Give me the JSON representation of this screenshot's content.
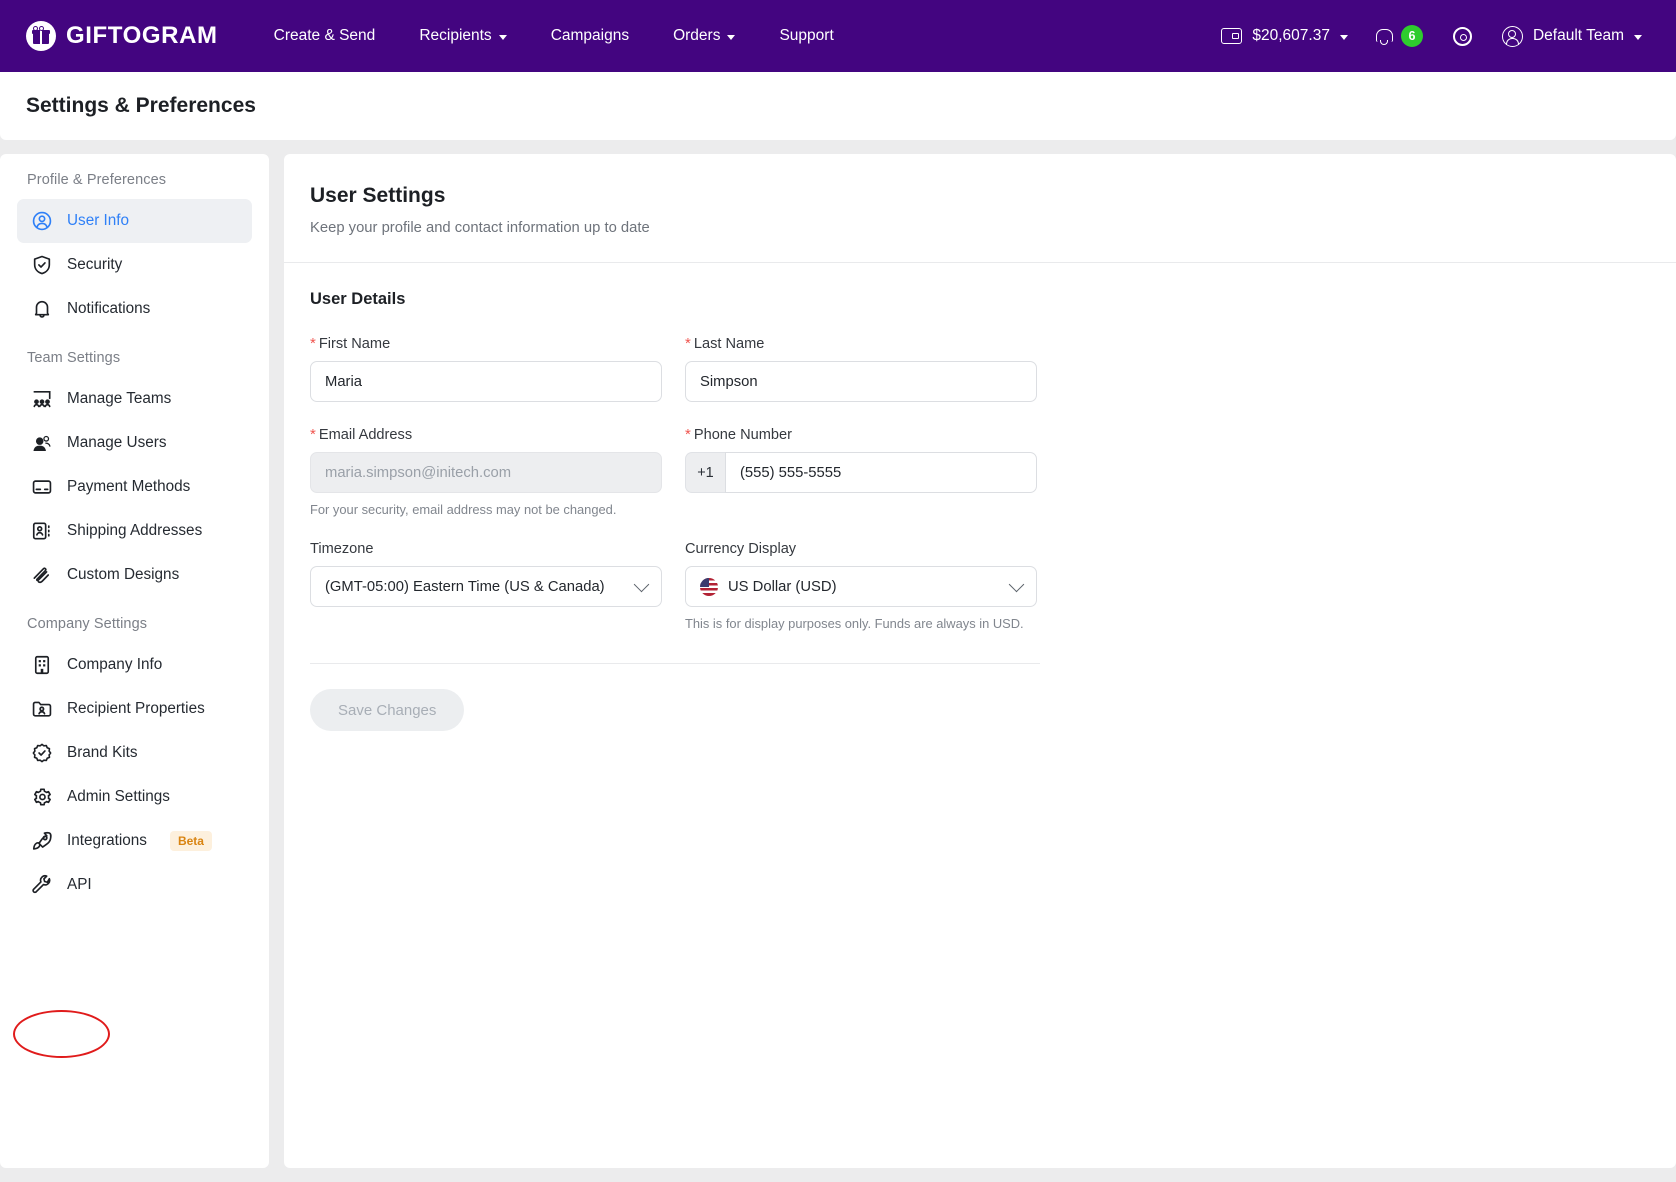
{
  "topnav": {
    "brand_name": "GIFTOGRAM",
    "links": [
      {
        "label": "Create & Send",
        "has_caret": false
      },
      {
        "label": "Recipients",
        "has_caret": true
      },
      {
        "label": "Campaigns",
        "has_caret": false
      },
      {
        "label": "Orders",
        "has_caret": true
      },
      {
        "label": "Support",
        "has_caret": false
      }
    ],
    "wallet_balance": "$20,607.37",
    "notification_count": "6",
    "team_label": "Default Team",
    "brand_color": "#430580",
    "badge_color": "#2ecc2e"
  },
  "page": {
    "title": "Settings & Preferences"
  },
  "sidebar": {
    "groups": [
      {
        "label": "Profile & Preferences",
        "items": [
          {
            "label": "User Info",
            "icon": "user-circle-icon",
            "active": true
          },
          {
            "label": "Security",
            "icon": "shield-check-icon",
            "active": false
          },
          {
            "label": "Notifications",
            "icon": "bell-icon",
            "active": false
          }
        ]
      },
      {
        "label": "Team Settings",
        "items": [
          {
            "label": "Manage Teams",
            "icon": "teams-icon",
            "active": false
          },
          {
            "label": "Manage Users",
            "icon": "users-icon",
            "active": false
          },
          {
            "label": "Payment Methods",
            "icon": "credit-card-icon",
            "active": false
          },
          {
            "label": "Shipping Addresses",
            "icon": "address-card-icon",
            "active": false
          },
          {
            "label": "Custom Designs",
            "icon": "scribble-icon",
            "active": false
          }
        ]
      },
      {
        "label": "Company Settings",
        "items": [
          {
            "label": "Company Info",
            "icon": "building-icon",
            "active": false
          },
          {
            "label": "Recipient Properties",
            "icon": "folder-user-icon",
            "active": false
          },
          {
            "label": "Brand Kits",
            "icon": "badge-check-icon",
            "active": false
          },
          {
            "label": "Admin Settings",
            "icon": "gear-icon",
            "active": false
          },
          {
            "label": "Integrations",
            "icon": "rocket-icon",
            "active": false,
            "badge": "Beta"
          },
          {
            "label": "API",
            "icon": "wrench-icon",
            "active": false,
            "annotated": true
          }
        ]
      }
    ],
    "annotation_color": "#e01b1b"
  },
  "main": {
    "title": "User Settings",
    "subtitle": "Keep your profile and contact information up to date",
    "section_title": "User Details",
    "fields": {
      "first_name": {
        "label": "First Name",
        "required": true,
        "value": "Maria"
      },
      "last_name": {
        "label": "Last Name",
        "required": true,
        "value": "Simpson"
      },
      "email": {
        "label": "Email Address",
        "required": true,
        "value": "maria.simpson@initech.com",
        "disabled": true,
        "helper": "For your security, email address may not be changed."
      },
      "phone": {
        "label": "Phone Number",
        "required": true,
        "country_prefix": "+1",
        "value": "(555) 555-5555"
      },
      "timezone": {
        "label": "Timezone",
        "required": false,
        "value": "(GMT-05:00) Eastern Time (US & Canada)"
      },
      "currency": {
        "label": "Currency Display",
        "required": false,
        "value": "US Dollar (USD)",
        "flag": "us-flag-icon",
        "helper": "This is for display purposes only. Funds are always in USD."
      }
    },
    "save_label": "Save Changes"
  }
}
